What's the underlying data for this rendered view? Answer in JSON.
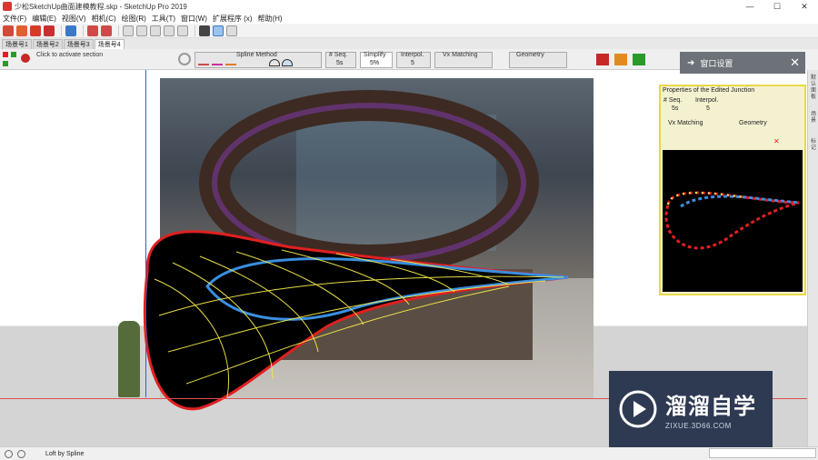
{
  "window": {
    "title": "少松SketchUp曲面建模教程.skp - SketchUp Pro 2019",
    "controls": [
      "—",
      "☐",
      "✕"
    ]
  },
  "menu": [
    "文件(F)",
    "编辑(E)",
    "视图(V)",
    "相机(C)",
    "绘图(R)",
    "工具(T)",
    "窗口(W)",
    "扩展程序 (x)",
    "帮助(H)"
  ],
  "scene_tabs": [
    "场景号1",
    "场景号2",
    "场景号3",
    "场景号4"
  ],
  "active_scene": 3,
  "curviloft": {
    "section_hint": "Click to activate section",
    "spline_method_label": "Spline Method",
    "seq_label": "# Seq.",
    "seq_value": "5s",
    "simplify_label": "Simplify",
    "simplify_value": "5%",
    "interpol_label": "Interpol.",
    "interpol_value": "5",
    "vx_matching_label": "Vx Matching",
    "geometry_label": "Geometry"
  },
  "panel": {
    "title": "窗口设置",
    "props_title": "Properties of the Edited Junction",
    "seq_label": "# Seq.",
    "seq_value": "5s",
    "interpol_label": "Interpol.",
    "interpol_value": "5",
    "vx_matching_label": "Vx Matching",
    "geometry_label": "Geometry"
  },
  "right_strip": [
    "默认面板",
    "场景",
    "标记"
  ],
  "status": {
    "text": "Loft by Spline"
  },
  "watermark": {
    "name": "溜溜自学",
    "url": "ZIXUE.3D66.COM"
  },
  "colors": {
    "accent_red": "#e02020",
    "spline_yellow": "#f2e84a",
    "spline_blue": "#3a8fe0",
    "panel_header": "#6d7278",
    "watermark_bg": "#2e3a52"
  }
}
